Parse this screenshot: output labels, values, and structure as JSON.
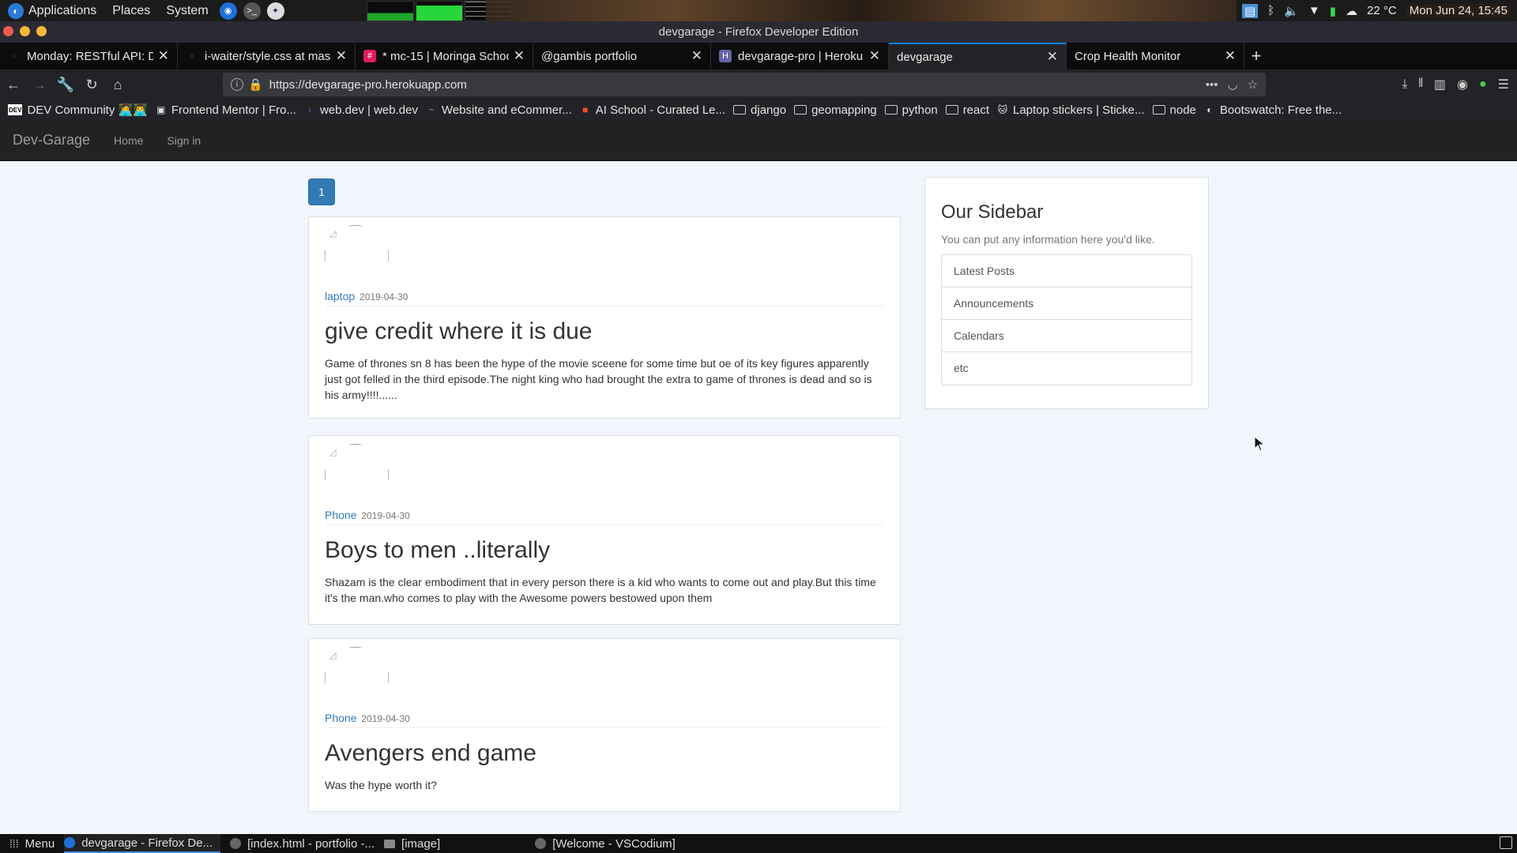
{
  "top_panel": {
    "menus": [
      "Applications",
      "Places",
      "System"
    ],
    "launchers": [
      "firefox-icon",
      "terminal-icon",
      "vscodium-icon"
    ],
    "tray": {
      "temperature": "22 °C",
      "clock": "Mon Jun 24, 15:45"
    }
  },
  "window": {
    "title": "devgarage - Firefox Developer Edition"
  },
  "tabs": [
    {
      "label": "Monday: RESTful API: Dj",
      "favicon": "○",
      "active": false
    },
    {
      "label": "i-waiter/style.css at mas",
      "favicon": "●",
      "active": false
    },
    {
      "label": "* mc-15 | Moringa Schoo",
      "favicon": "#",
      "active": false
    },
    {
      "label": "@gambis portfolio",
      "favicon": "",
      "active": false
    },
    {
      "label": "devgarage-pro | Heroku",
      "favicon": "H",
      "active": false
    },
    {
      "label": "devgarage",
      "favicon": "",
      "active": true
    },
    {
      "label": "Crop Health Monitor",
      "favicon": "",
      "active": false
    }
  ],
  "nav": {
    "url": "https://devgarage-pro.herokuapp.com"
  },
  "bookmarks": [
    {
      "label": "DEV Community 👩‍💻👨‍💻",
      "icon": "DEV"
    },
    {
      "label": "Frontend Mentor | Fro...",
      "icon": "▣"
    },
    {
      "label": "web.dev  |  web.dev",
      "icon": "›"
    },
    {
      "label": "Website and eCommer...",
      "icon": "~"
    },
    {
      "label": "AI School - Curated Le...",
      "icon": "■"
    },
    {
      "label": "django",
      "icon": "folder"
    },
    {
      "label": "geomapping",
      "icon": "folder"
    },
    {
      "label": "python",
      "icon": "folder"
    },
    {
      "label": "react",
      "icon": "folder"
    },
    {
      "label": "Laptop stickers | Sticke...",
      "icon": "🐱"
    },
    {
      "label": "node",
      "icon": "folder"
    },
    {
      "label": "Bootswatch: Free the...",
      "icon": "◐"
    }
  ],
  "site": {
    "brand": "Dev-Garage",
    "links": [
      "Home",
      "Sign in"
    ],
    "page_number": "1"
  },
  "posts": [
    {
      "category": "laptop",
      "date": "2019-04-30",
      "title": "give credit where it is due",
      "body": "Game of thrones sn 8 has been the hype of the movie sceene for some time but oe of its key figures apparently just got felled in the third episode.The night king who had brought the extra to game of thrones is dead and so is his army!!!!......"
    },
    {
      "category": "Phone",
      "date": "2019-04-30",
      "title": "Boys to men ..literally",
      "body": "Shazam is the clear embodiment that in every person there is a kid who wants to come out and play.But this time it's the man.who comes to play with the Awesome powers bestowed upon them"
    },
    {
      "category": "Phone",
      "date": "2019-04-30",
      "title": "Avengers end game",
      "body": "Was the hype worth it?"
    }
  ],
  "sidebar": {
    "title": "Our Sidebar",
    "lead": "You can put any information here you'd like.",
    "items": [
      "Latest Posts",
      "Announcements",
      "Calendars",
      "etc"
    ]
  },
  "taskbar": {
    "menu_label": "Menu",
    "items": [
      {
        "label": "devgarage - Firefox De...",
        "icon": "firefox-icon",
        "active": true
      },
      {
        "label": "[index.html - portfolio -...",
        "icon": "vscodium-icon",
        "active": false
      },
      {
        "label": "[image]",
        "icon": "folder-icon",
        "active": false
      },
      {
        "label": "[Welcome - VSCodium]",
        "icon": "vscodium-icon",
        "active": false
      }
    ]
  },
  "colors": {
    "accent": "#337ab7",
    "navbar_bg": "#222222",
    "page_bg": "#f0f6fc",
    "active_tab_line": "#0a84ff"
  }
}
